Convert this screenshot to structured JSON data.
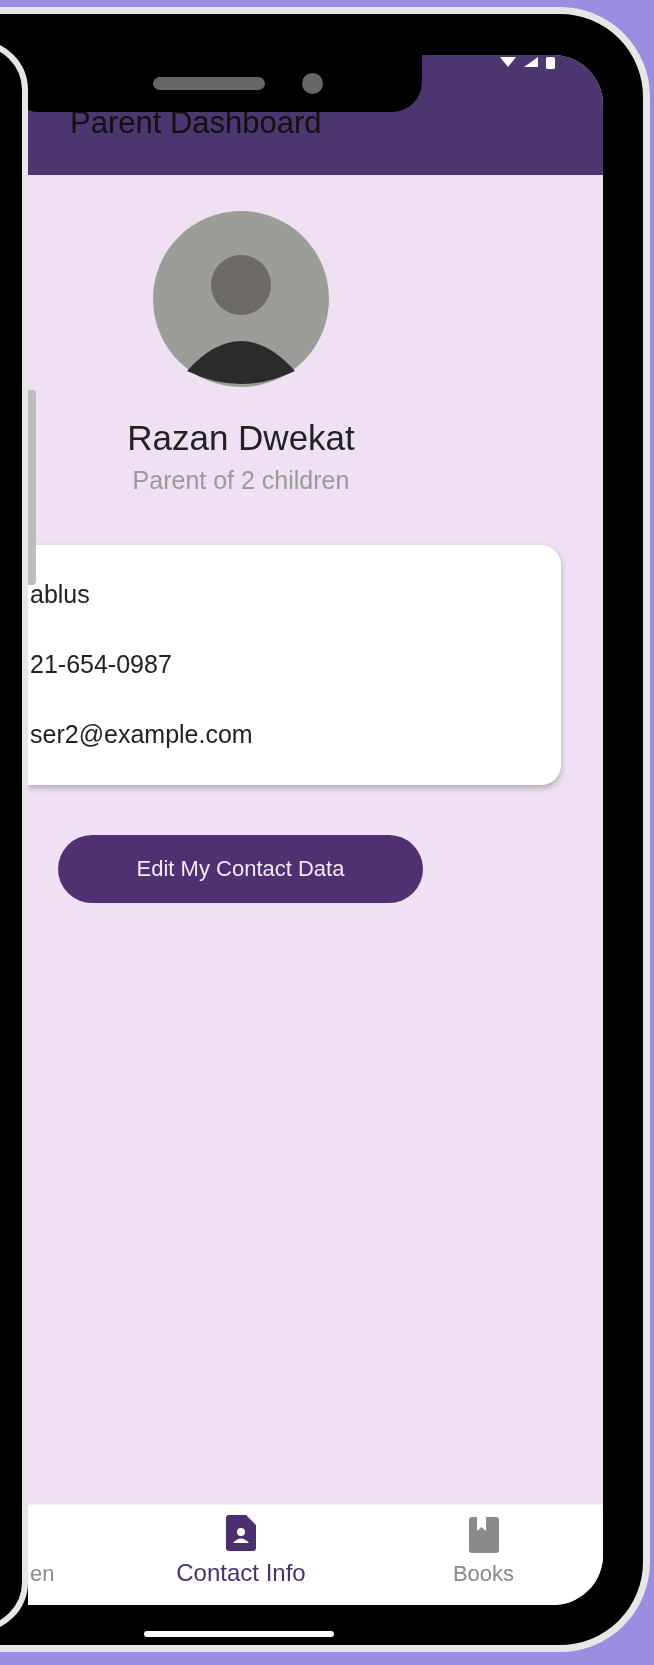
{
  "app_bar": {
    "title": "Parent Dashboard"
  },
  "profile": {
    "name": "Razan Dwekat",
    "subtitle": "Parent of 2 children"
  },
  "contact_card": {
    "rows": [
      "ablus",
      "21-654-0987",
      "ser2@example.com"
    ]
  },
  "edit_button": {
    "label": "Edit My Contact Data"
  },
  "bottom_nav": [
    {
      "label": "en",
      "selected": false
    },
    {
      "label": "Contact Info",
      "selected": true
    },
    {
      "label": "Books",
      "selected": false
    }
  ]
}
